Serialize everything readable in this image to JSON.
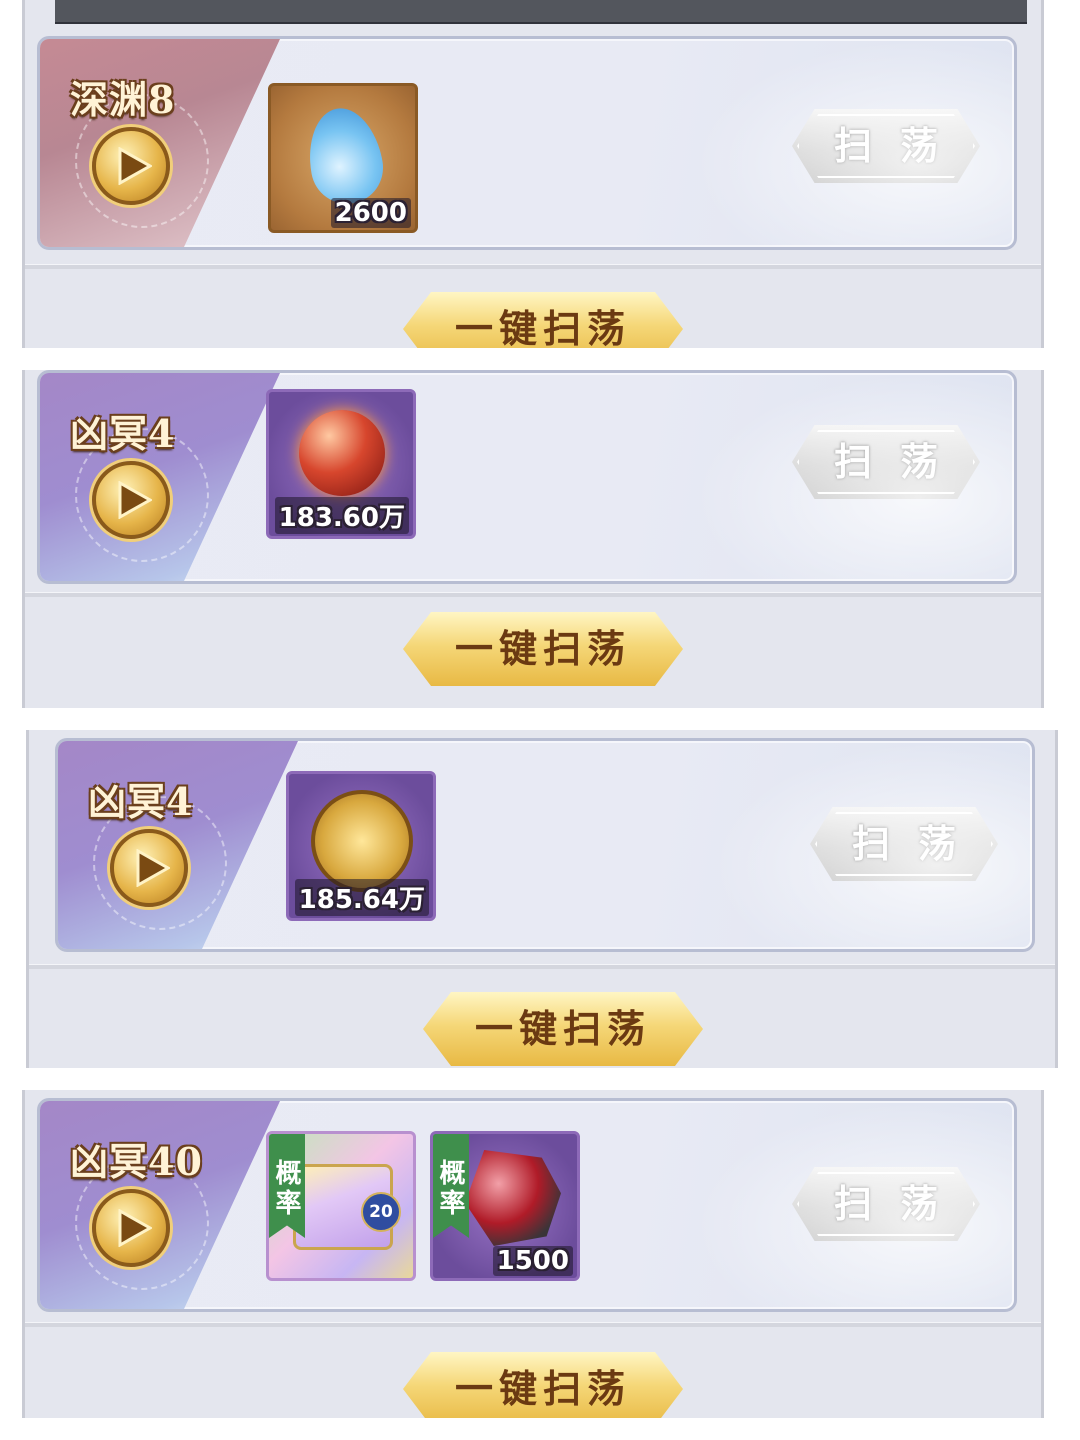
{
  "stages": [
    {
      "name": "深渊8",
      "theme": "red",
      "items": [
        {
          "kind": "water-drop",
          "qty": "2600"
        }
      ]
    },
    {
      "name": "凶冥4",
      "theme": "purple",
      "items": [
        {
          "kind": "fire-orb",
          "qty": "183.60万"
        }
      ]
    },
    {
      "name": "凶冥4",
      "theme": "purple",
      "items": [
        {
          "kind": "gold-coin",
          "qty": "185.64万"
        }
      ]
    },
    {
      "name": "凶冥40",
      "theme": "purple",
      "items": [
        {
          "kind": "treasure-chest",
          "tag": "概率",
          "level": "20"
        },
        {
          "kind": "red-ore",
          "tag": "概率",
          "qty": "1500"
        }
      ]
    }
  ],
  "buttons": {
    "sweep": "扫荡",
    "one_key_sweep": "一键扫荡"
  },
  "colors": {
    "gold": "#e8b944",
    "silver": "#cfcfcf",
    "probability_tag": "#3f8f4c"
  }
}
